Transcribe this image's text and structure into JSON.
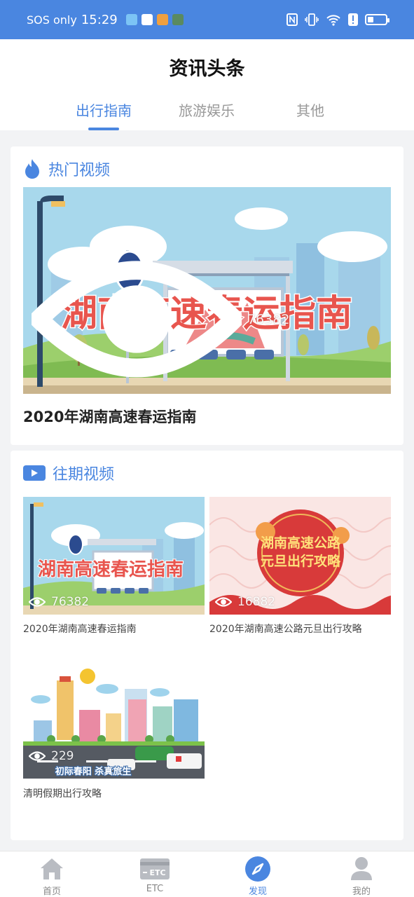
{
  "status_bar": {
    "carrier": "SOS only",
    "time": "15:29"
  },
  "header": {
    "title": "资讯头条",
    "tabs": [
      {
        "label": "出行指南",
        "active": true
      },
      {
        "label": "旅游娱乐",
        "active": false
      },
      {
        "label": "其他",
        "active": false
      }
    ]
  },
  "hot_videos": {
    "section_title": "热门视频",
    "featured": {
      "title": "2020年湖南高速春运指南",
      "views": "76382",
      "banner_text": "湖南高速春运指南"
    }
  },
  "past_videos": {
    "section_title": "往期视频",
    "items": [
      {
        "title": "2020年湖南高速春运指南",
        "views": "76382",
        "banner_text": "湖南高速春运指南"
      },
      {
        "title": "2020年湖南高速公路元旦出行攻略",
        "views": "16882",
        "banner_line1": "湖南高速公路",
        "banner_line2": "元旦出行攻略"
      },
      {
        "title": "清明假期出行攻略",
        "views": "229",
        "banner_text": "初际春阳 杀真旅生"
      }
    ]
  },
  "bottom_nav": [
    {
      "label": "首页",
      "icon": "home-icon",
      "active": false
    },
    {
      "label": "ETC",
      "icon": "etc-card-icon",
      "active": false
    },
    {
      "label": "发现",
      "icon": "compass-icon",
      "active": true
    },
    {
      "label": "我的",
      "icon": "user-icon",
      "active": false
    }
  ],
  "colors": {
    "primary": "#4a86e0",
    "banner_red": "#e8554e",
    "background": "#f2f3f5"
  }
}
